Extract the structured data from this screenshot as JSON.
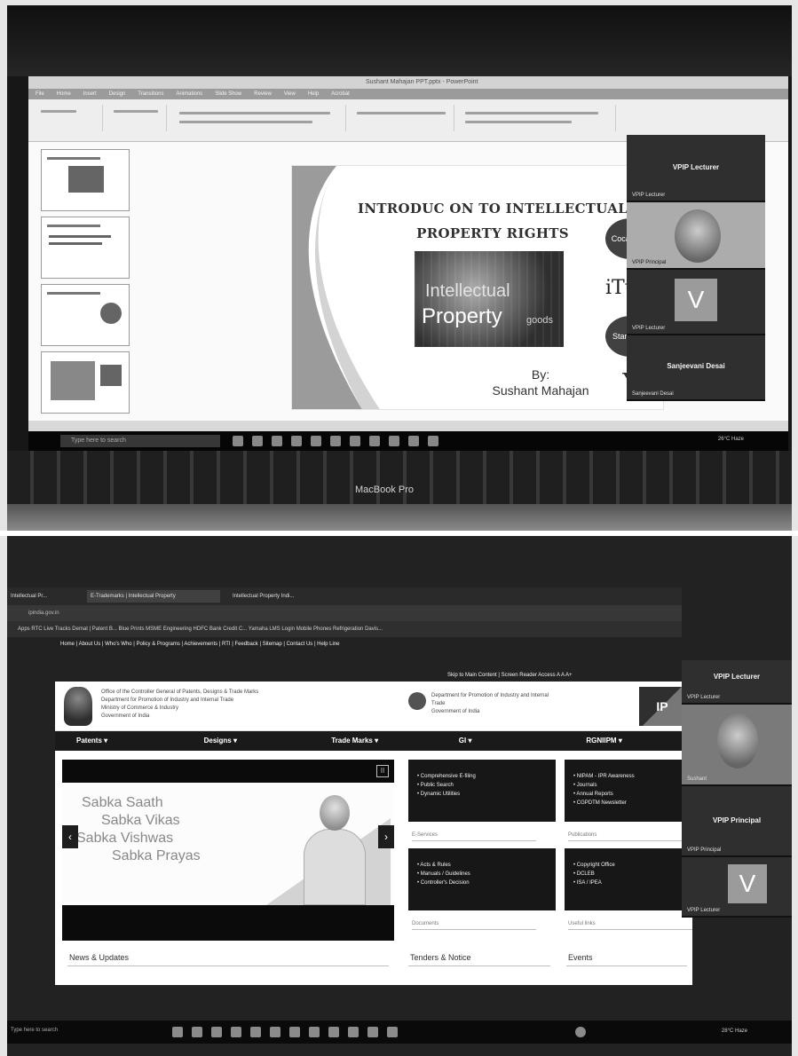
{
  "top_photo": {
    "app": {
      "window_title": "Sushant Mahajan PPT.pptx - PowerPoint",
      "ribbon_tabs": [
        "File",
        "Home",
        "Insert",
        "Design",
        "Transitions",
        "Animations",
        "Slide Show",
        "Review",
        "View",
        "Help",
        "Acrobat"
      ]
    },
    "slide": {
      "title_line1": "INTRODUC  ON TO INTELLECTUAL",
      "title_line2": "PROPERTY RIGHTS",
      "image_word1": "Intellectual",
      "image_word2": "Property",
      "image_word3": "goods",
      "by_label": "By:",
      "author": "Sushant Mahajan"
    },
    "logos": [
      "Coca-Cola",
      "iTunes",
      "Starbucks",
      "Y"
    ],
    "zoom": {
      "header": "VPIP Lecturer",
      "tile1_label": "VPIP Lecturer",
      "tile2_label": "VPIP Principal",
      "tile3_avatar": "V",
      "tile3_label": "VPIP Lecturer",
      "tile4_center": "Sanjeevani Desai",
      "tile4_label": "Sanjeevani Desai"
    },
    "taskbar": {
      "search_placeholder": "Type here to search",
      "tray_text": "26°C Haze"
    },
    "laptop_label": "MacBook Pro"
  },
  "bottom_photo": {
    "browser": {
      "tabs": [
        "Intellectual Pr...",
        "E-Trademarks | Intellectual Property",
        "Intellectual Property Indi..."
      ],
      "address": "ipindia.gov.in",
      "bookmarks": "Apps   RTC Live Tracks   Demat | Patent B...   Blue Prints   MSME Engineering   HDFC Bank Credit C...   Yamaha LMS Login   Mobile Phones   Refrigeration Davis..."
    },
    "site": {
      "top_nav": "Home | About Us | Who's Who | Policy & Programs | Achievements | RTI | Feedback | Sitemap | Contact Us | Help Line",
      "accessibility": "Skip to Main Content | Screen Reader Access  A  A  A+",
      "header_text": "Office of the Controller General of Patents, Designs & Trade Marks\nDepartment for Promotion of Industry and Internal Trade\nMinistry of Commerce & Industry\nGovernment of India",
      "dpiit_text": "Department for Promotion of Industry and Internal Trade\nGovernment of India",
      "logo_text": "IP",
      "menu": [
        "Patents ▾",
        "Designs ▾",
        "Trade Marks ▾",
        "GI ▾",
        "RGNIIPM ▾"
      ],
      "slogan": [
        "Sabka Saath",
        "Sabka Vikas",
        "Sabka Vishwas",
        "Sabka Prayas"
      ],
      "card1": "• Comprehensive E-filing\n• Public Search\n• Dynamic Utilities",
      "card1_select": "E-Services",
      "card2": "• NIPAM - IPR Awareness\n• Journals\n• Annual Reports\n• CGPDTM Newsletter",
      "card2_select": "Publications",
      "card3": "• Acts & Rules\n• Manuals / Guidelines\n• Controller's Decision",
      "card3_select": "Documents",
      "card4": "• Copyright Office\n• DCLEB\n• ISA / IPEA",
      "card4_select": "Useful links",
      "news_label": "News & Updates",
      "tenders_label": "Tenders & Notice",
      "events_label": "Events"
    },
    "zoom": {
      "header": "VPIP Lecturer",
      "tile1_label": "VPIP Lecturer",
      "tile2_label": "Sushant",
      "tile3_center": "VPIP Principal",
      "tile3_label": "VPIP Principal",
      "tile4_avatar": "V",
      "tile4_label": "VPIP Lecturer"
    },
    "taskbar": {
      "search_placeholder": "Type here to search",
      "tray_text": "28°C Haze"
    }
  }
}
